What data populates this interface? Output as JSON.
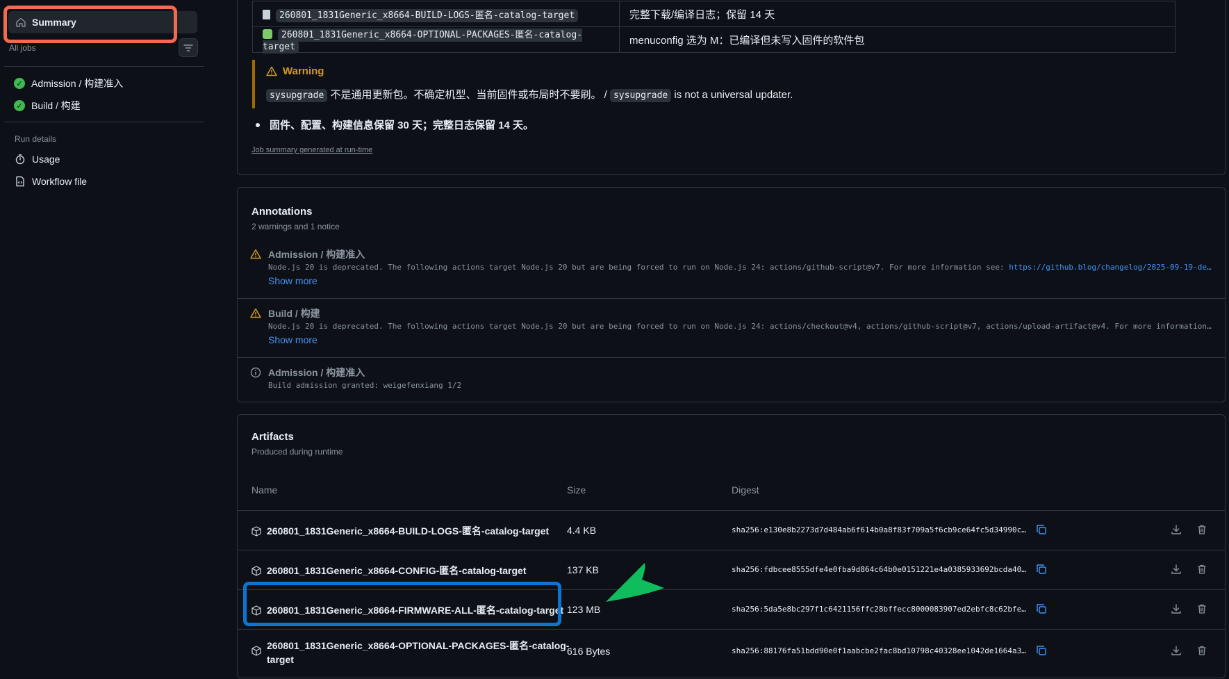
{
  "sidebar": {
    "summary_label": "Summary",
    "all_jobs_label": "All jobs",
    "jobs": [
      {
        "label": "Admission / 构建准入"
      },
      {
        "label": "Build / 构建"
      }
    ],
    "run_details_label": "Run details",
    "links": [
      {
        "label": "Usage",
        "icon": "stopwatch-icon"
      },
      {
        "label": "Workflow file",
        "icon": "file-icon"
      }
    ]
  },
  "summary": {
    "table_rows": [
      {
        "icon": "document-icon",
        "name": "260801_1831Generic_x8664-BUILD-LOGS-匿名-catalog-target",
        "desc": "完整下载/编译日志；保留 14 天"
      },
      {
        "icon": "puzzle-icon",
        "name": "260801_1831Generic_x8664-OPTIONAL-PACKAGES-匿名-catalog-target",
        "desc": "menuconfig 选为 M：已编译但未写入固件的软件包"
      }
    ],
    "warning_title": "Warning",
    "warning_code1": "sysupgrade",
    "warning_text1": " 不是通用更新包。不确定机型、当前固件或布局时不要刷。 / ",
    "warning_code2": "sysupgrade",
    "warning_text2": " is not a universal updater.",
    "bullet": "固件、配置、构建信息保留 30 天；完整日志保留 14 天。",
    "generated_note": "Job summary generated at run-time"
  },
  "annotations": {
    "title": "Annotations",
    "subtitle": "2 warnings and 1 notice",
    "items": [
      {
        "type": "warning",
        "title": "Admission / 构建准入",
        "message": "Node.js 20 is deprecated. The following actions target Node.js 20 but are being forced to run on Node.js 24: actions/github-script@v7. For more information see: ",
        "link": "https://github.blog/changelog/2025-09-19-de…",
        "show_more": "Show more"
      },
      {
        "type": "warning",
        "title": "Build / 构建",
        "message": "Node.js 20 is deprecated. The following actions target Node.js 20 but are being forced to run on Node.js 24: actions/checkout@v4, actions/github-script@v7, actions/upload-artifact@v4. For more information…",
        "link": "",
        "show_more": "Show more"
      },
      {
        "type": "notice",
        "title": "Admission / 构建准入",
        "message": "Build admission granted: weigefenxiang 1/2",
        "link": "",
        "show_more": ""
      }
    ]
  },
  "artifacts": {
    "title": "Artifacts",
    "subtitle": "Produced during runtime",
    "columns": {
      "name": "Name",
      "size": "Size",
      "digest": "Digest"
    },
    "rows": [
      {
        "name": "260801_1831Generic_x8664-BUILD-LOGS-匿名-catalog-target",
        "size": "4.4 KB",
        "digest": "sha256:e130e8b2273d7d484ab6f614b0a8f83f709a5f6cb9ce64fc5d34990c7…"
      },
      {
        "name": "260801_1831Generic_x8664-CONFIG-匿名-catalog-target",
        "size": "137 KB",
        "digest": "sha256:fdbcee8555dfe4e0fba9d864c64b0e0151221e4a0385933692bcda40b…"
      },
      {
        "name": "260801_1831Generic_x8664-FIRMWARE-ALL-匿名-catalog-target",
        "size": "123 MB",
        "digest": "sha256:5da5e8bc297f1c6421156ffc28bffecc8000083907ed2ebfc8c62bfe8…"
      },
      {
        "name_line1": "260801_1831Generic_x8664-OPTIONAL-PACKAGES-匿名-catalog-",
        "name_line2": "target",
        "size": "616 Bytes",
        "digest": "sha256:88176fa51bdd90e0f1aabcbe2fac8bd10798c40328ee1042de1664a36…"
      }
    ]
  },
  "colors": {
    "background": "#0d1117",
    "success": "#3fb950",
    "warning": "#d29922",
    "link": "#4493f8",
    "highlight_red": "#f26b4f",
    "highlight_blue": "#0b75d1",
    "pointer_green": "#0fbd5c"
  }
}
